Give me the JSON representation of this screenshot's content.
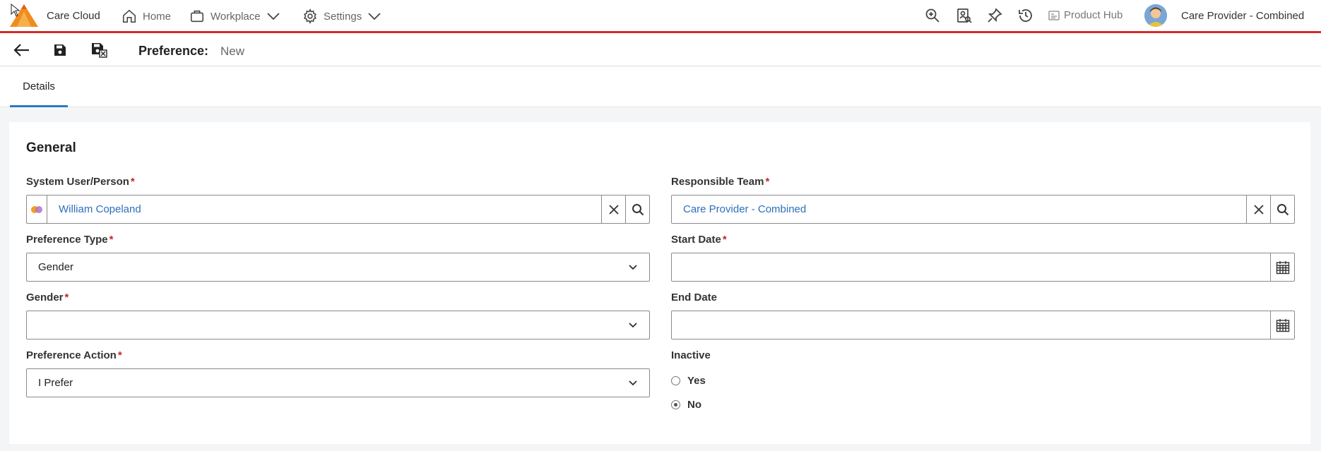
{
  "nav": {
    "app_name": "Care Cloud",
    "items": [
      {
        "label": "Home",
        "icon": "home-icon"
      },
      {
        "label": "Workplace",
        "icon": "briefcase-icon"
      },
      {
        "label": "Settings",
        "icon": "gear-icon"
      }
    ],
    "right_icons": [
      "zoom-in-icon",
      "person-search-icon",
      "pin-icon",
      "history-icon"
    ],
    "product_hub": "Product Hub",
    "user": "Care Provider - Combined"
  },
  "page": {
    "title": "Preference:",
    "subtitle": "New"
  },
  "tabs": [
    {
      "label": "Details"
    }
  ],
  "form": {
    "section_title": "General",
    "system_user": {
      "label": "System User/Person",
      "value": "William Copeland"
    },
    "responsible_team": {
      "label": "Responsible Team",
      "value": "Care Provider - Combined"
    },
    "preference_type": {
      "label": "Preference Type",
      "value": "Gender"
    },
    "start_date": {
      "label": "Start Date",
      "value": ""
    },
    "gender": {
      "label": "Gender",
      "value": ""
    },
    "end_date": {
      "label": "End Date",
      "value": ""
    },
    "preference_action": {
      "label": "Preference Action",
      "value": "I Prefer"
    },
    "inactive": {
      "label": "Inactive",
      "options": [
        "Yes",
        "No"
      ],
      "selected": "No"
    }
  },
  "colors": {
    "accent": "#2e78c7",
    "brand_red": "#d62b2b",
    "required": "#c0272d",
    "link": "#2e6fba"
  }
}
